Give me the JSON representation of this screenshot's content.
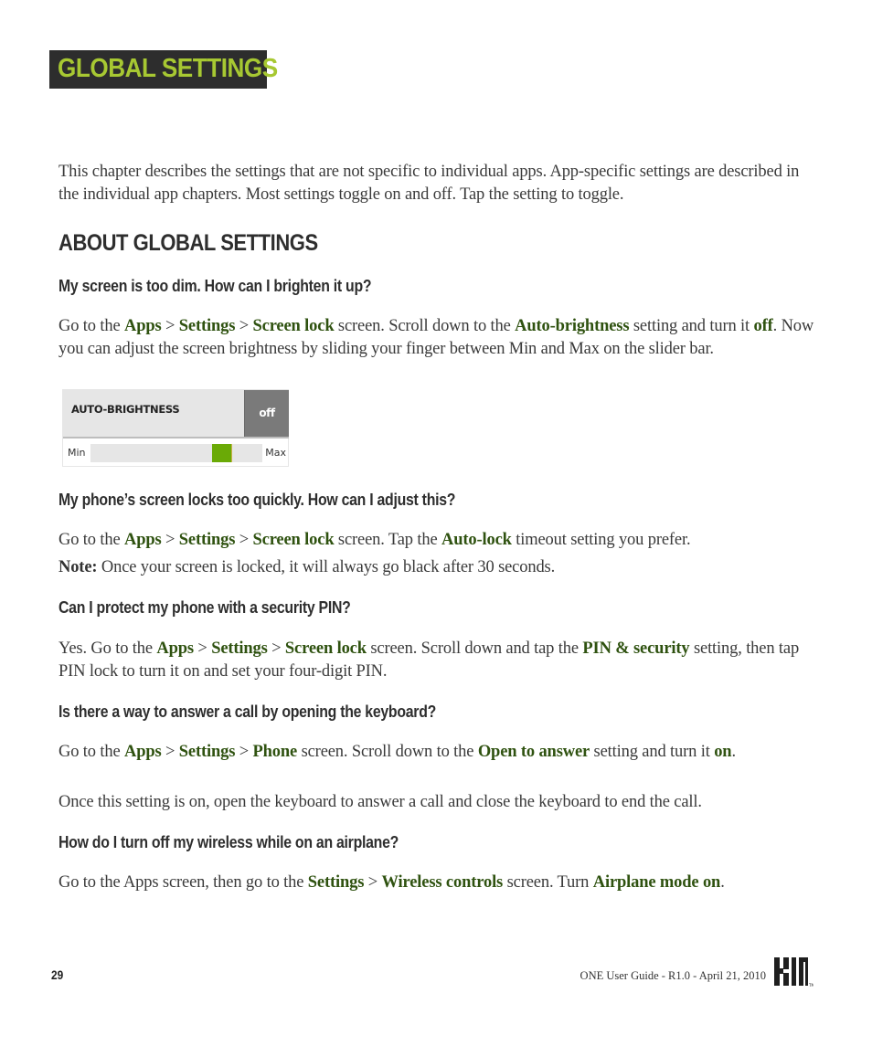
{
  "chapter": {
    "title": "GLOBAL SETTINGS"
  },
  "intro": "This chapter describes the settings that are not specific to individual apps. App-specific settings are described in the individual app chapters. Most settings toggle on and off. Tap the setting to toggle.",
  "section": {
    "title": "ABOUT GLOBAL SETTINGS"
  },
  "faq": [
    {
      "question": "My screen is too dim. How can I brighten it up?",
      "answer": {
        "t1": "Go to the ",
        "b1": "Apps",
        "t2": " > ",
        "b2": "Settings",
        "t3": " > ",
        "b3": "Screen lock",
        "t4": " screen. Scroll down to the ",
        "b4": "Auto-brightness",
        "t5": " setting and turn it ",
        "b5": "off",
        "t6": ". Now you can adjust the screen brightness by sliding your finger between Min and Max on the slider bar."
      }
    },
    {
      "question": "My phone’s screen locks too quickly. How can I adjust this?",
      "answer": {
        "t1": "Go to the ",
        "b1": "Apps",
        "t2": " > ",
        "b2": "Settings",
        "t3": " > ",
        "b3": "Screen lock",
        "t4": " screen. Tap the ",
        "b4": "Auto-lock",
        "t5": " timeout setting you prefer."
      },
      "note": {
        "label": "Note:",
        "text": " Once your screen is locked, it will always go black after 30 seconds."
      }
    },
    {
      "question": "Can I protect my phone with a security PIN?",
      "answer": {
        "t1": "Yes. Go to the ",
        "b1": "Apps",
        "t2": " > ",
        "b2": "Settings",
        "t3": " > ",
        "b3": "Screen lock",
        "t4": " screen. Scroll down and tap the ",
        "b4": "PIN & security",
        "t5": " setting, then tap PIN lock to turn it on and set your four-digit PIN."
      }
    },
    {
      "question": "Is there a way to answer a call by opening the keyboard?",
      "answer": {
        "t1": "Go to the ",
        "b1": "Apps",
        "t2": " > ",
        "b2": "Settings",
        "t3": " > ",
        "b3": "Phone",
        "t4": " screen. Scroll down to the ",
        "b4": "Open to answer",
        "t5": " setting and turn it ",
        "b5": "on",
        "t6": "."
      },
      "extra": "Once this setting is on, open the keyboard to answer a call and close the keyboard to end the call."
    },
    {
      "question": "How do I turn off my wireless while on an airplane?",
      "answer": {
        "t1": "Go to the Apps screen, then go to the ",
        "b1": "Settings",
        "t2": " > ",
        "b2": "Wireless controls",
        "t3": " screen. Turn ",
        "b3": "Airplane mode on",
        "t4": "."
      }
    }
  ],
  "widget": {
    "label": "AUTO-BRIGHTNESS",
    "toggle": "off",
    "slider_min": "Min",
    "slider_max": "Max",
    "slider_value": 0.8
  },
  "footer": {
    "page_number": "29",
    "guide": "ONE User Guide - R1.0 - April 21, 2010",
    "logo": "KIN",
    "trademark": "TM"
  },
  "colors": {
    "accent": "#a7c832",
    "highlight": "#2f5210",
    "banner": "#2d2d2d",
    "slider_thumb": "#6aaa06"
  }
}
